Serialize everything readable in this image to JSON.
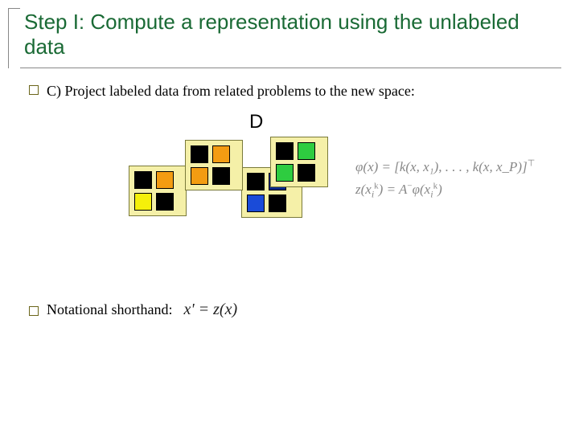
{
  "title": "Step I: Compute a representation using the unlabeled data",
  "bullets": {
    "c": " C) Project labeled data from related problems to the new space:",
    "shorthand": "Notational shorthand:"
  },
  "labels": {
    "D": "D"
  },
  "math": {
    "phi": "φ(x) = [k(x, x₁), . . . , k(x, x_P)]",
    "phi_sup": "⊤",
    "z": "z(x",
    "z_sub1": "i",
    "z_sup1": "k",
    "z_mid": ") = A",
    "z_sup2": "−",
    "z_end": "φ(x",
    "z_sub2": "i",
    "z_sup3": "k",
    "z_close": ")",
    "shorthand": "x' = z(x)"
  }
}
